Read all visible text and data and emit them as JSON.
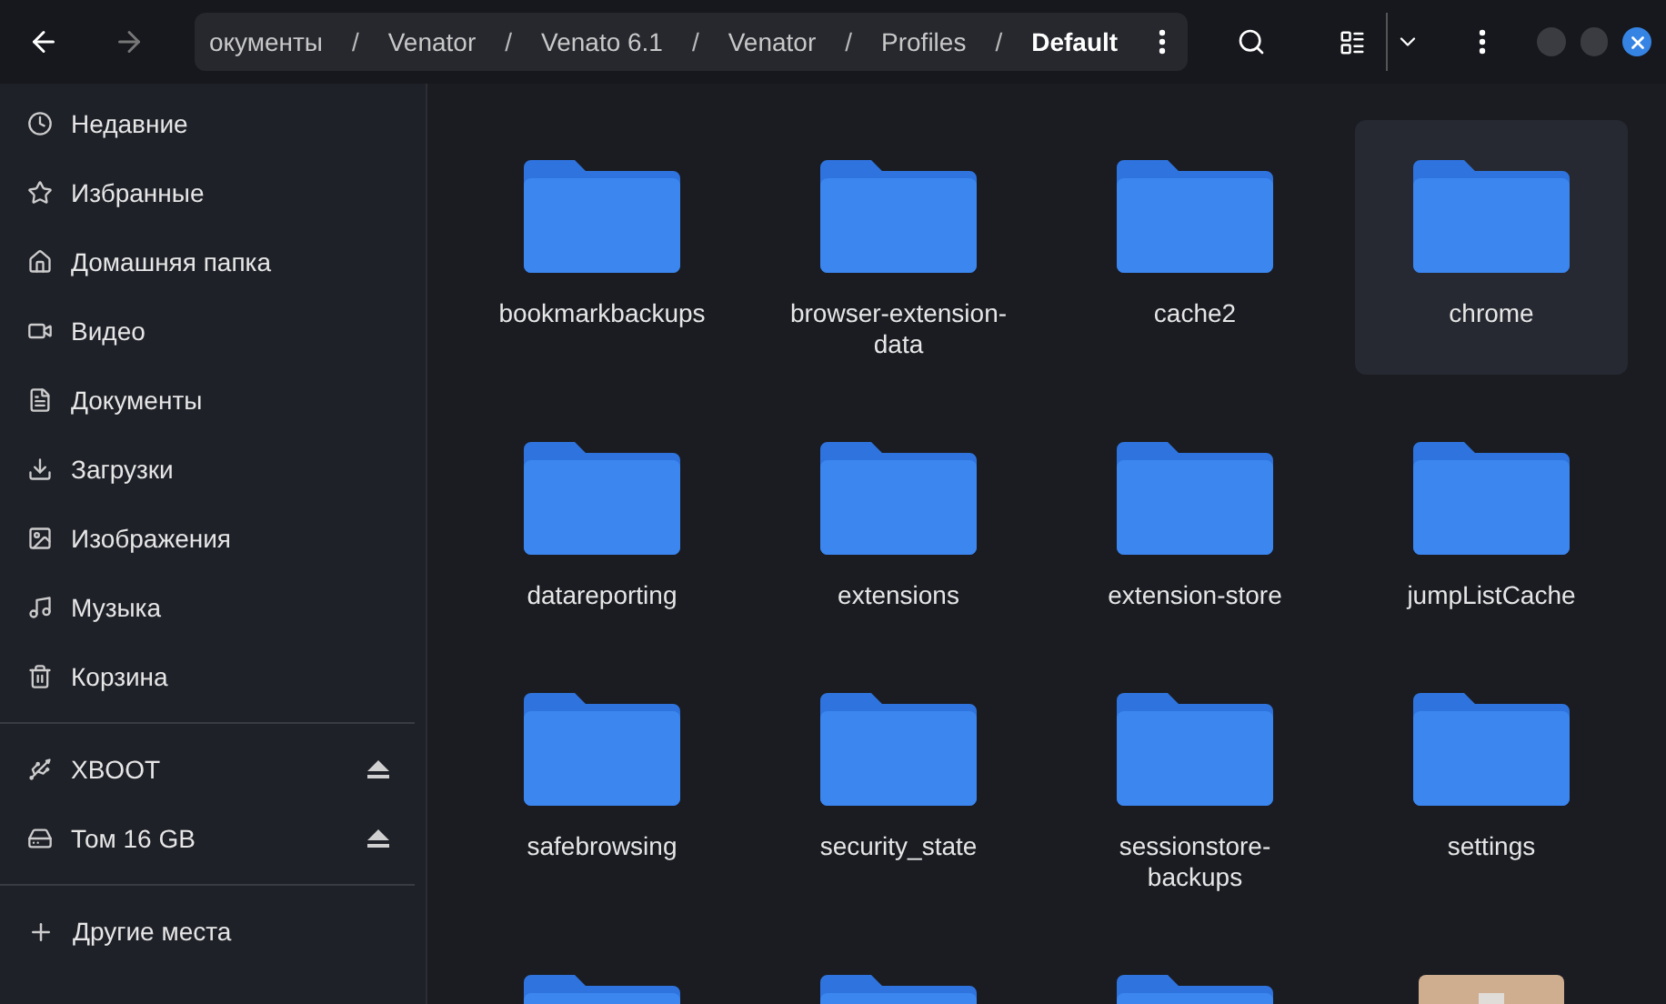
{
  "breadcrumb": [
    {
      "label": "окументы",
      "current": false
    },
    {
      "separator": "/",
      "label": "Venator",
      "current": false
    },
    {
      "separator": "/",
      "label": "Venato 6.1",
      "current": false
    },
    {
      "separator": "/",
      "label": "Venator",
      "current": false
    },
    {
      "separator": "/",
      "label": "Profiles",
      "current": false
    },
    {
      "separator": "/",
      "label": "Default",
      "current": true
    }
  ],
  "sidebar": {
    "places": [
      {
        "label": "Недавние"
      },
      {
        "label": "Избранные"
      },
      {
        "label": "Домашняя папка"
      },
      {
        "label": "Видео"
      },
      {
        "label": "Документы"
      },
      {
        "label": "Загрузки"
      },
      {
        "label": "Изображения"
      },
      {
        "label": "Музыка"
      },
      {
        "label": "Корзина"
      }
    ],
    "devices": [
      {
        "label": "XBOOT",
        "ejectable": true
      },
      {
        "label": "Том 16 GB",
        "ejectable": true
      }
    ],
    "other": {
      "label": "Другие места"
    }
  },
  "items": [
    {
      "kind": "folder",
      "name": "bookmarkbackups",
      "selected": false
    },
    {
      "kind": "folder",
      "name": "browser-extension-data",
      "selected": false
    },
    {
      "kind": "folder",
      "name": "cache2",
      "selected": false
    },
    {
      "kind": "folder",
      "name": "chrome",
      "selected": true
    },
    {
      "kind": "folder",
      "name": "datareporting",
      "selected": false
    },
    {
      "kind": "folder",
      "name": "extensions",
      "selected": false
    },
    {
      "kind": "folder",
      "name": "extension-store",
      "selected": false
    },
    {
      "kind": "folder",
      "name": "jumpListCache",
      "selected": false
    },
    {
      "kind": "folder",
      "name": "safebrowsing",
      "selected": false
    },
    {
      "kind": "folder",
      "name": "security_state",
      "selected": false
    },
    {
      "kind": "folder",
      "name": "sessionstore-backups",
      "selected": false
    },
    {
      "kind": "folder",
      "name": "settings",
      "selected": false
    },
    {
      "kind": "folder",
      "selected": false
    },
    {
      "kind": "folder",
      "selected": false
    },
    {
      "kind": "folder",
      "selected": false
    },
    {
      "kind": "archive",
      "selected": false
    }
  ]
}
